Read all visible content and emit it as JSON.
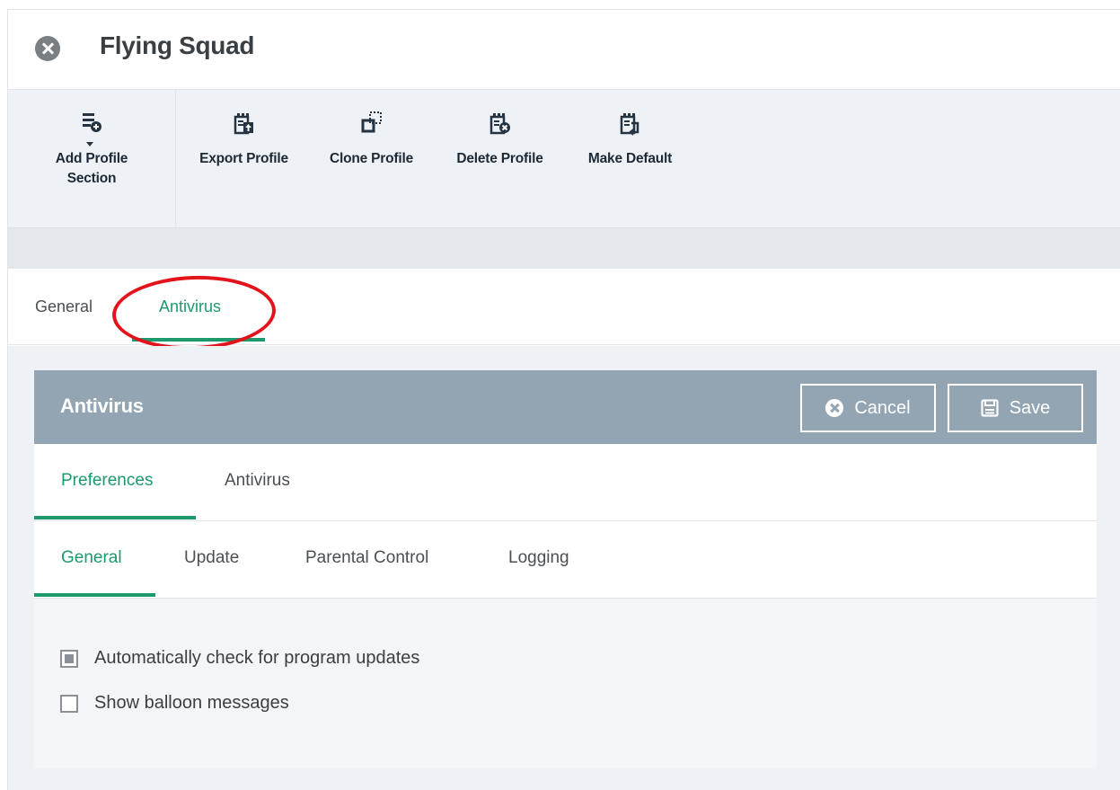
{
  "title": "Flying Squad",
  "toolbar": {
    "add_profile_line1": "Add Profile",
    "add_profile_line2": "Section",
    "export_profile": "Export Profile",
    "clone_profile": "Clone Profile",
    "delete_profile": "Delete Profile",
    "make_default": "Make Default"
  },
  "top_tabs": {
    "general": "General",
    "antivirus": "Antivirus",
    "active": "Antivirus"
  },
  "panel": {
    "title": "Antivirus",
    "cancel_label": "Cancel",
    "save_label": "Save"
  },
  "subtabs": {
    "preferences": "Preferences",
    "antivirus": "Antivirus",
    "active": "Preferences"
  },
  "pref_tabs": {
    "general": "General",
    "update": "Update",
    "parental_control": "Parental Control",
    "logging": "Logging",
    "active": "General"
  },
  "options": [
    {
      "label": "Automatically check for program updates",
      "checked": true
    },
    {
      "label": "Show balloon messages",
      "checked": false
    }
  ],
  "colors": {
    "accent": "#1c9a6c",
    "panel_header": "#93a4b2",
    "annotation": "#e3131b"
  }
}
